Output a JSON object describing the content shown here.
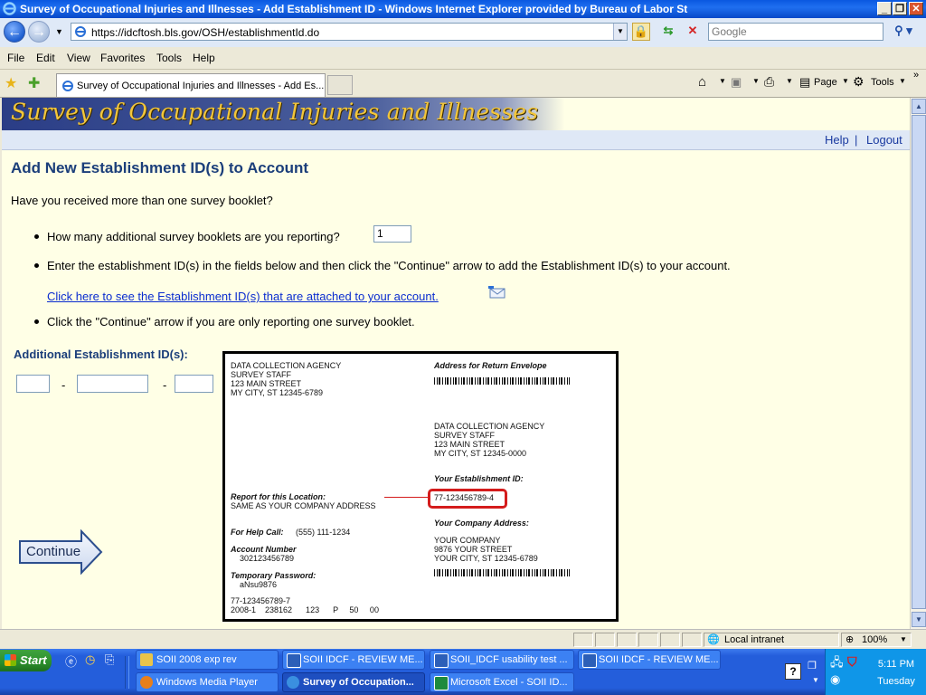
{
  "window": {
    "title": "Survey of Occupational Injuries and Illnesses - Add Establishment ID - Windows Internet Explorer provided by Bureau of Labor St"
  },
  "address_bar": {
    "url": "https://idcftosh.bls.gov/OSH/establishmentId.do",
    "search_placeholder": "Google"
  },
  "menu": [
    "File",
    "Edit",
    "View",
    "Favorites",
    "Tools",
    "Help"
  ],
  "tab": {
    "title": "Survey of Occupational Injuries and Illnesses - Add Es..."
  },
  "command_bar": {
    "page_label": "Page",
    "tools_label": "Tools"
  },
  "page": {
    "banner_title": "Survey of Occupational Injuries and Illnesses",
    "help_link": "Help",
    "separator": "|",
    "logout_link": "Logout",
    "heading": "Add New Establishment ID(s) to Account",
    "question": "Have you received more than one survey booklet?",
    "bullet1": "How many additional survey booklets are you reporting?",
    "booklet_count": "1",
    "bullet2": "Enter the establishment ID(s) in the fields below and then click the \"Continue\" arrow to add the Establishment ID(s) to your account.",
    "attached_link": "Click here to see the Establishment ID(s) that are attached to your account.",
    "bullet3": "Click the \"Continue\" arrow if you are only reporting one survey booklet.",
    "additional_label": "Additional Establishment ID(s):",
    "id_dash": "-",
    "continue_label": "Continue"
  },
  "sample_label": {
    "agency_block": [
      "DATA COLLECTION AGENCY",
      "SURVEY STAFF",
      "123 MAIN STREET",
      "MY CITY, ST  12345-6789"
    ],
    "return_envelope_label": "Address for Return Envelope",
    "return_block": [
      "DATA COLLECTION AGENCY",
      "SURVEY STAFF",
      "123 MAIN STREET",
      "MY CITY, ST  12345-0000"
    ],
    "est_id_label": "Your Establishment ID:",
    "est_id_value": "77-123456789-4",
    "report_label": "Report for this Location:",
    "report_value": "SAME AS YOUR COMPANY ADDRESS",
    "company_addr_label": "Your Company Address:",
    "help_call_label": "For Help Call:",
    "help_call_value": "(555) 111-1234",
    "company_block": [
      "YOUR COMPANY",
      "9876 YOUR STREET",
      "YOUR CITY, ST 12345-6789"
    ],
    "account_label": "Account Number",
    "account_value": "302123456789",
    "temp_pw_label": "Temporary Password:",
    "temp_pw_value": "aNsu9876",
    "footer_line1": "77-123456789-7",
    "footer_line2": "2008-1    238162      123      P     50     00"
  },
  "status_bar": {
    "zone": "Local intranet",
    "zoom": "100%"
  },
  "taskbar": {
    "start": "Start",
    "row1": [
      {
        "label": "SOII 2008 exp rev",
        "color": "#e8c44a"
      },
      {
        "label": "SOII IDCF - REVIEW ME...",
        "color": "#2c5fb8"
      },
      {
        "label": "SOII_IDCF usability test ...",
        "color": "#2c5fb8"
      },
      {
        "label": "SOII IDCF - REVIEW ME...",
        "color": "#2c5fb8"
      }
    ],
    "row2": [
      {
        "label": "Windows Media Player",
        "color": "#e87f1a"
      },
      {
        "label": "Survey of Occupation...",
        "color": "#3a8fe0"
      },
      {
        "label": "Microsoft Excel - SOII ID...",
        "color": "#1e8a3c"
      }
    ],
    "clock_time": "5:11 PM",
    "clock_day": "Tuesday"
  }
}
